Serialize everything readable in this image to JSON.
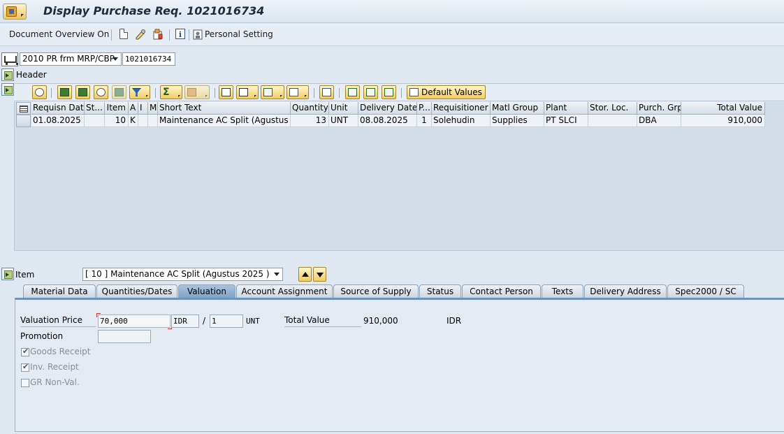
{
  "title": "Display Purchase Req. 1021016734",
  "toolbar": {
    "document_overview": "Document Overview On",
    "personal_setting": "Personal Setting"
  },
  "header_row": {
    "doc_type": "2010 PR frm MRP/CBP",
    "doc_number": "1021016734",
    "header_label": "Header"
  },
  "grid_toolbar": {
    "default_values": "Default Values"
  },
  "grid": {
    "columns": [
      "Requisn Date",
      "St...",
      "Item",
      "A",
      "I",
      "M...",
      "Short Text",
      "Quantity",
      "Unit",
      "Delivery Date",
      "P...",
      "Requisitioner",
      "Matl Group",
      "Plant",
      "Stor. Loc.",
      "Purch. Grp",
      "Total Value"
    ],
    "row": {
      "requisn_date": "01.08.2025",
      "status": "",
      "item": "10",
      "a": "K",
      "i": "",
      "m": "",
      "short_text": "Maintenance AC Split (Agustus ...",
      "quantity": "13",
      "unit": "UNT",
      "delivery_date": "08.08.2025",
      "p": "1",
      "requisitioner": "Solehudin",
      "matl_group": "Supplies",
      "plant": "PT SLCI",
      "stor_loc": "",
      "purch_grp": "DBA",
      "total_value": "910,000"
    }
  },
  "item_area": {
    "label": "Item",
    "selected_item": "[ 10 ] Maintenance AC Split (Agustus 2025 )"
  },
  "tabs": [
    "Material Data",
    "Quantities/Dates",
    "Valuation",
    "Account Assignment",
    "Source of Supply",
    "Status",
    "Contact Person",
    "Texts",
    "Delivery Address",
    "Spec2000 / SC"
  ],
  "active_tab": "Valuation",
  "valuation": {
    "valuation_price_label": "Valuation Price",
    "valuation_price": "70,000",
    "currency": "IDR",
    "slash": "/",
    "price_unit": "1",
    "unit": "UNT",
    "total_value_label": "Total Value",
    "total_value": "910,000",
    "total_currency": "IDR",
    "promotion_label": "Promotion",
    "promotion": "",
    "goods_receipt_label": "Goods Receipt",
    "goods_receipt_checked": true,
    "inv_receipt_label": "Inv. Receipt",
    "inv_receipt_checked": true,
    "gr_nonval_label": "GR Non-Val.",
    "gr_nonval_checked": false
  }
}
